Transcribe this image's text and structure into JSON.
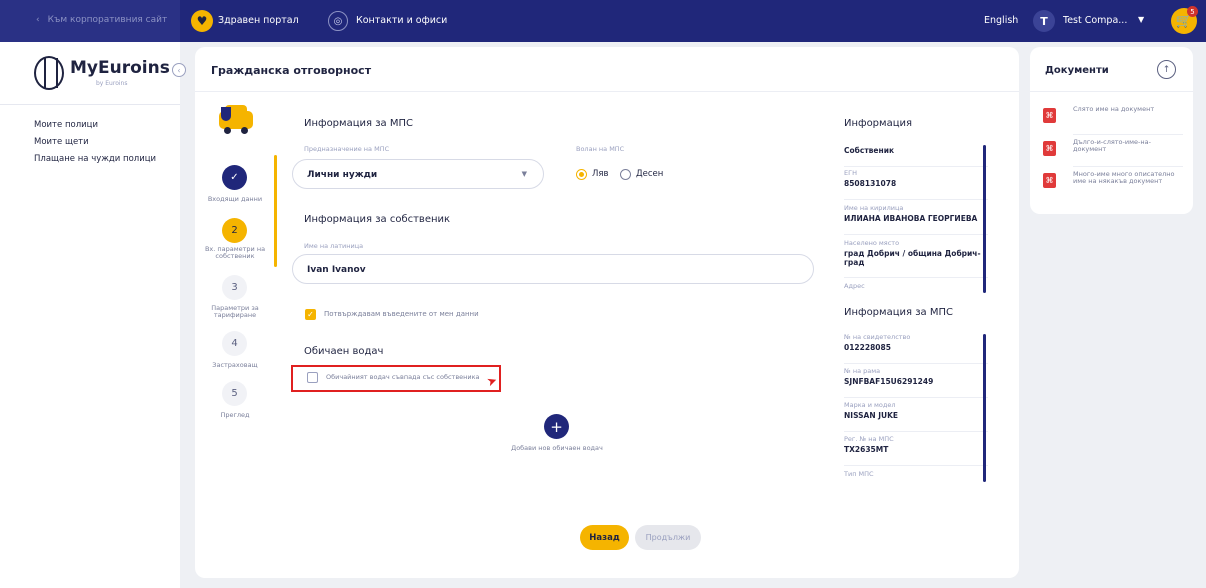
{
  "topbar": {
    "back_label": "Към корпоративния сайт",
    "health_label": "Здравен портал",
    "contacts_label": "Контакти и офиси",
    "language": "English",
    "user_initial": "T",
    "user_name": "Test Compa...",
    "cart_count": "5"
  },
  "sidebar": {
    "logo_name": "MyEuroins",
    "logo_sub": "by Euroins",
    "items": [
      {
        "label": "Моите полици"
      },
      {
        "label": "Моите щети"
      },
      {
        "label": "Плащане на чужди полици"
      }
    ]
  },
  "main": {
    "title": "Гражданска отговорност",
    "steps": [
      {
        "number": "",
        "label": "Входящи данни",
        "state": "done"
      },
      {
        "number": "2",
        "label": "Вх. параметри на собственик",
        "state": "active"
      },
      {
        "number": "3",
        "label": "Параметри за тарифиране",
        "state": "todo"
      },
      {
        "number": "4",
        "label": "Застраховащ",
        "state": "todo"
      },
      {
        "number": "5",
        "label": "Преглед",
        "state": "todo"
      }
    ],
    "vehicle_section": {
      "title": "Информация за МПС",
      "purpose_label": "Предназначение на МПС",
      "purpose_value": "Лични нужди",
      "steering_label": "Волан на МПС",
      "steering_options": [
        {
          "label": "Ляв",
          "selected": true
        },
        {
          "label": "Десен",
          "selected": false
        }
      ]
    },
    "owner_section": {
      "title": "Информация за собственик",
      "name_label": "Име на латиница",
      "name_value": "Ivan Ivanov",
      "confirm_label": "Потвърждавам въведените от мен данни",
      "confirm_checked": true
    },
    "driver_section": {
      "title": "Обичаен водач",
      "same_as_owner_label": "Обичайният водач съвпада със собственика",
      "same_as_owner_checked": false
    },
    "add_driver_label": "Добави нов обичаен водач",
    "back_button": "Назад",
    "next_button": "Продължи"
  },
  "info": {
    "title": "Информация",
    "owner_heading": "Собственик",
    "owner_items": [
      {
        "label": "ЕГН",
        "value": "8508131078"
      },
      {
        "label": "Име на кирилица",
        "value": "ИЛИАНА ИВАНОВА ГЕОРГИЕВА"
      },
      {
        "label": "Населено място",
        "value": "град Добрич / община Добрич-град"
      },
      {
        "label": "Адрес",
        "value": ""
      }
    ],
    "vehicle_title": "Информация за МПС",
    "vehicle_items": [
      {
        "label": "№ на свидетелство",
        "value": "012228085"
      },
      {
        "label": "№ на рама",
        "value": "SJNFBAF15U6291249"
      },
      {
        "label": "Марка и модел",
        "value": "NISSAN JUKE"
      },
      {
        "label": "Рег. № на МПС",
        "value": "TX2635MT"
      },
      {
        "label": "Тип МПС",
        "value": ""
      }
    ]
  },
  "documents": {
    "title": "Документи",
    "items": [
      {
        "name": "Слято име на документ"
      },
      {
        "name": "Дълго-и-слято-име-на-документ"
      },
      {
        "name": "Много-име много описателно име на някакъв документ"
      }
    ]
  },
  "colors": {
    "navy": "#20277a",
    "accent": "#f5b400",
    "highlight": "#e02020",
    "pdf": "#e03a3a"
  }
}
